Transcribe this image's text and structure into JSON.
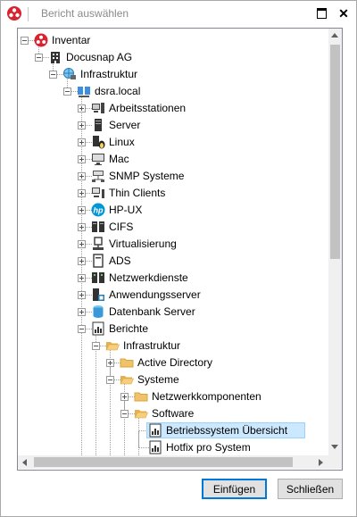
{
  "window": {
    "title": "Bericht auswählen",
    "close_glyph": "✕"
  },
  "tree": {
    "nodes": [
      {
        "label": "Inventar",
        "icon": "docusnap-logo-icon",
        "expander": "minus"
      },
      {
        "label": "Docusnap AG",
        "icon": "building-icon",
        "expander": "minus"
      },
      {
        "label": "Infrastruktur",
        "icon": "globe-network-icon",
        "expander": "minus"
      },
      {
        "label": "dsra.local",
        "icon": "domain-computers-icon",
        "expander": "minus"
      },
      {
        "label": "Arbeitsstationen",
        "icon": "workstation-icon",
        "expander": "plus"
      },
      {
        "label": "Server",
        "icon": "server-icon",
        "expander": "plus"
      },
      {
        "label": "Linux",
        "icon": "linux-icon",
        "expander": "plus"
      },
      {
        "label": "Mac",
        "icon": "mac-icon",
        "expander": "plus"
      },
      {
        "label": "SNMP Systeme",
        "icon": "snmp-icon",
        "expander": "plus"
      },
      {
        "label": "Thin Clients",
        "icon": "thin-client-icon",
        "expander": "plus"
      },
      {
        "label": "HP-UX",
        "icon": "hp-logo-icon",
        "expander": "plus"
      },
      {
        "label": "CIFS",
        "icon": "cifs-icon",
        "expander": "plus"
      },
      {
        "label": "Virtualisierung",
        "icon": "virtualization-icon",
        "expander": "plus"
      },
      {
        "label": "ADS",
        "icon": "ads-icon",
        "expander": "plus"
      },
      {
        "label": "Netzwerkdienste",
        "icon": "network-services-icon",
        "expander": "plus"
      },
      {
        "label": "Anwendungsserver",
        "icon": "application-server-icon",
        "expander": "plus"
      },
      {
        "label": "Datenbank Server",
        "icon": "database-icon",
        "expander": "plus"
      },
      {
        "label": "Berichte",
        "icon": "report-icon",
        "expander": "minus"
      },
      {
        "label": "Infrastruktur",
        "icon": "folder-open-icon",
        "expander": "minus"
      },
      {
        "label": "Active Directory",
        "icon": "folder-icon",
        "expander": "plus"
      },
      {
        "label": "Systeme",
        "icon": "folder-open-icon",
        "expander": "minus"
      },
      {
        "label": "Netzwerkkomponenten",
        "icon": "folder-icon",
        "expander": "plus"
      },
      {
        "label": "Software",
        "icon": "folder-open-icon",
        "expander": "minus"
      },
      {
        "label": "Betriebssystem Übersicht",
        "icon": "report-icon",
        "expander": "none",
        "selected": true
      },
      {
        "label": "Hotfix pro System",
        "icon": "report-icon",
        "expander": "none"
      }
    ]
  },
  "buttons": {
    "insert_label": "Einfügen",
    "close_label": "Schließen"
  },
  "colors": {
    "selection_bg": "#cce8ff",
    "primary_border": "#0078d7",
    "folder": "#f0c36b",
    "brand_red": "#d9232e"
  }
}
